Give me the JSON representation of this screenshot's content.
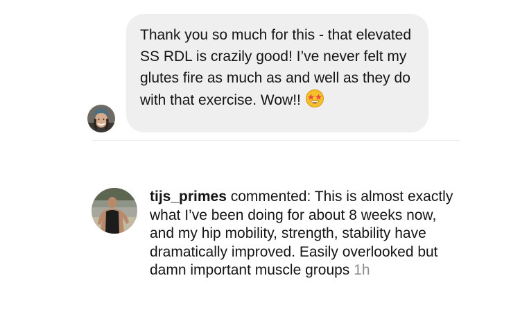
{
  "message": {
    "sender_avatar_icon": "user-avatar-icon",
    "text": "Thank you so much for this - that elevated SS RDL is crazily good! I’ve never felt my glutes fire as much as and well as they do with that exercise. Wow!!",
    "emoji_icon": "star-struck-emoji-icon",
    "bubble_color": "#efefef"
  },
  "comment": {
    "avatar_icon": "user-avatar-icon",
    "username": "tijs_primes",
    "action": "commented:",
    "text": "This is almost exactly what I’ve been doing for about 8 weeks now, and my hip mobility, strength, stability have dramatically improved. Easily overlooked but damn important muscle groups",
    "timestamp": "1h",
    "timestamp_color": "#8e8e8e"
  }
}
